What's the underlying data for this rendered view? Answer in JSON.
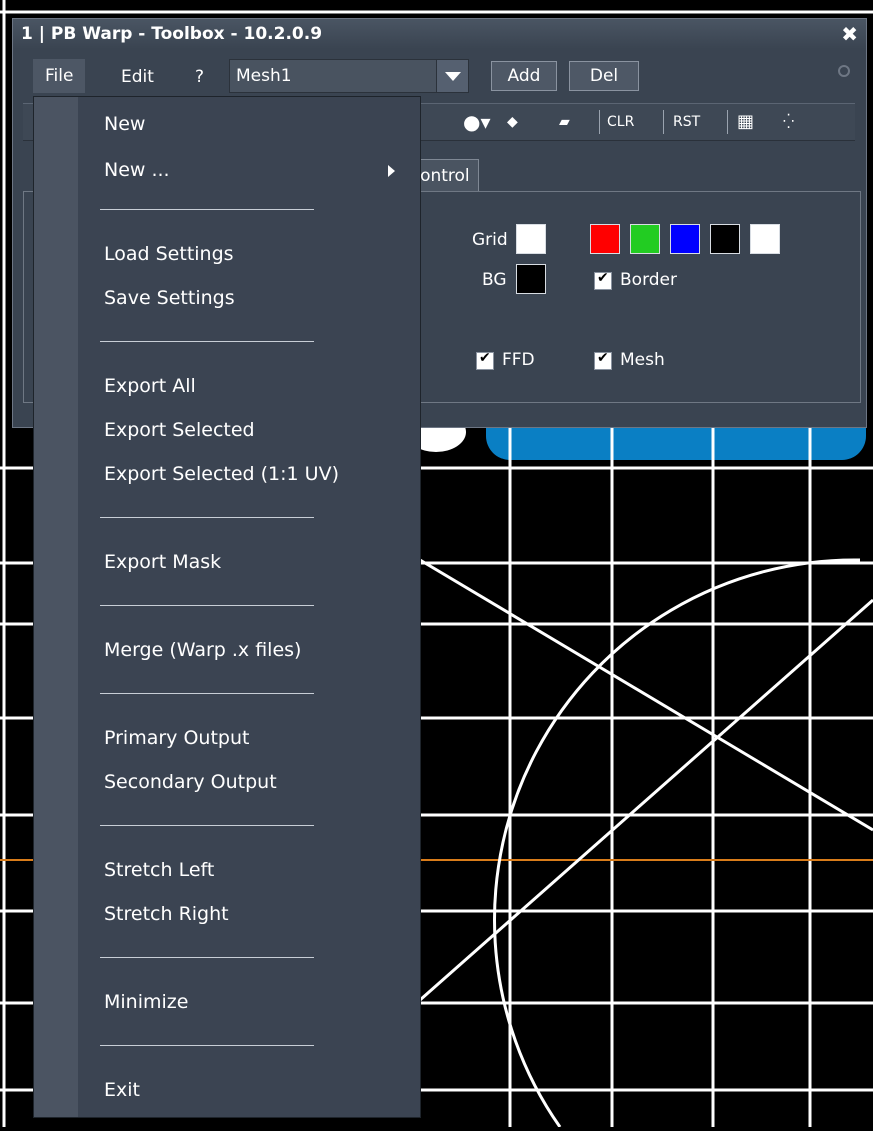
{
  "window": {
    "title": "1 | PB Warp - Toolbox - 10.2.0.9",
    "close_label": "✖"
  },
  "menubar": {
    "items": [
      {
        "label": "File"
      },
      {
        "label": "Edit"
      },
      {
        "label": "?"
      }
    ],
    "mesh_select": {
      "value": "Mesh1"
    },
    "add_label": "Add",
    "del_label": "Del"
  },
  "toolstrip": {
    "items": [
      {
        "label": "CLR"
      },
      {
        "label": "RST"
      }
    ]
  },
  "tab": {
    "label": "d Control"
  },
  "panel": {
    "grid_label": "Grid",
    "bg_label": "BG",
    "border_label": "Border",
    "ffd_label": "FFD",
    "mesh_label": "Mesh",
    "grid_color": "#ffffff",
    "bg_color": "#000000",
    "palette": [
      "#ff0000",
      "#22cc22",
      "#0000ff",
      "#000000",
      "#ffffff"
    ],
    "border_checked": true,
    "ffd_checked": true,
    "mesh_checked": true
  },
  "file_menu": {
    "items": [
      {
        "label": "New",
        "type": "item"
      },
      {
        "label": "New ...",
        "type": "submenu"
      },
      {
        "type": "separator"
      },
      {
        "label": "Load Settings",
        "type": "item"
      },
      {
        "label": "Save Settings",
        "type": "item"
      },
      {
        "type": "separator"
      },
      {
        "label": "Export All",
        "type": "item"
      },
      {
        "label": "Export Selected",
        "type": "item"
      },
      {
        "label": "Export Selected (1:1 UV)",
        "type": "item"
      },
      {
        "type": "separator"
      },
      {
        "label": "Export Mask",
        "type": "item"
      },
      {
        "type": "separator"
      },
      {
        "label": "Merge (Warp .x files)",
        "type": "item"
      },
      {
        "type": "separator"
      },
      {
        "label": "Primary Output",
        "type": "item"
      },
      {
        "label": "Secondary Output",
        "type": "item"
      },
      {
        "type": "separator"
      },
      {
        "label": "Stretch Left",
        "type": "item"
      },
      {
        "label": "Stretch Right",
        "type": "item"
      },
      {
        "type": "separator"
      },
      {
        "label": "Minimize",
        "type": "item"
      },
      {
        "type": "separator"
      },
      {
        "label": "Exit",
        "type": "item"
      }
    ]
  }
}
